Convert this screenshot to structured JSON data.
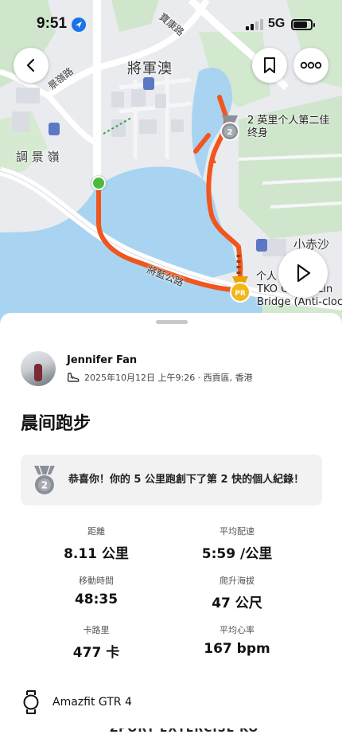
{
  "status_bar": {
    "time": "9:51",
    "network": "5G"
  },
  "map": {
    "labels": {
      "tseung_kwan_o": "將軍澳",
      "po_hong_road": "寶康路",
      "king_ling_road": "景嶺路",
      "tiu_keng_leng": "調 景 嶺",
      "siu_chik_sha": "小赤沙",
      "po_tsui": "寶…",
      "tseung_lam_road": "將藍公路",
      "rank_text": "2 英里个人第二佳\n终身",
      "bridge_line1": "TKO Ca… y Lin",
      "bridge_line2": "Bridge (Anti-clock",
      "pr_partial": "个人",
      "lohas": "寶琳…"
    },
    "colors": {
      "route": "#f0561d",
      "water": "#a9d4f1",
      "park": "#cde7c9",
      "road": "#ffffff"
    },
    "badges": {
      "pr": "PR",
      "rank": "2"
    }
  },
  "buttons": {
    "back_icon": "chevron-left-icon",
    "bookmark_icon": "bookmark-icon",
    "more_icon": "more-horizontal-icon",
    "play_icon": "play-icon"
  },
  "athlete": {
    "name": "Jennifer Fan",
    "meta": "2025年10月12日 上午9:26 · 西貢區, 香港"
  },
  "activity": {
    "title": "晨间跑步"
  },
  "achievement": {
    "rank": "2",
    "text": "恭喜你！你的 5 公里跑創下了第 2 快的個人紀錄！"
  },
  "stats": [
    {
      "label": "距離",
      "value": "8.11 公里"
    },
    {
      "label": "平均配速",
      "value": "5:59 /公里"
    },
    {
      "label": "移動時間",
      "value": "48:35"
    },
    {
      "label": "爬升海拔",
      "value": "47 公尺"
    },
    {
      "label": "卡路里",
      "value": "477 卡"
    },
    {
      "label": "平均心率",
      "value": "167 bpm"
    }
  ],
  "device": {
    "name": "Amazfit GTR 4",
    "icon": "watch-icon"
  },
  "cut_text": "ZPORT EXTERCISE KO"
}
